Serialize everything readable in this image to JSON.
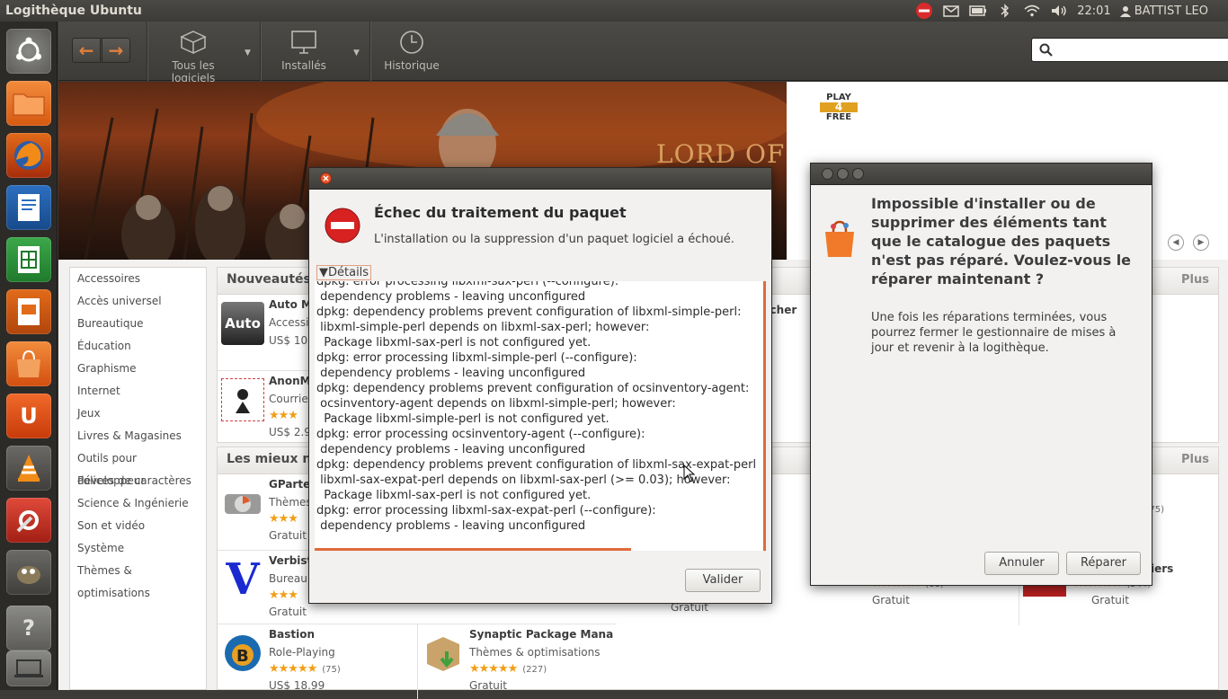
{
  "panel": {
    "title": "Logithèque Ubuntu",
    "time": "22:01",
    "user": "BATTIST LEO"
  },
  "toolbar": {
    "back": "←",
    "forward": "→",
    "all_software": "Tous les logiciels",
    "installed": "Installés",
    "history": "Historique",
    "search_placeholder": ""
  },
  "banner": {
    "text": "LORD OF",
    "logo_top": "PLAY",
    "logo_mid": "4",
    "logo_bot": "FREE"
  },
  "categories": [
    "Accessoires",
    "Accès universel",
    "Bureautique",
    "Éducation",
    "Graphisme",
    "Internet",
    "Jeux",
    "Livres & Magasines",
    "Outils pour développeur",
    "Polices de caractères",
    "Science & Ingénierie",
    "Son et vidéo",
    "Système",
    "Thèmes & optimisations"
  ],
  "sections": {
    "new": "Nouveautés",
    "top": "Les mieux no",
    "plus": "Plus"
  },
  "apps": {
    "automa": {
      "name": "Auto Mo",
      "cat": "Accessi",
      "price": "US$ 10"
    },
    "anonma": {
      "name": "AnonMa",
      "cat": "Courrie",
      "price": "US$ 2.9"
    },
    "gparted": {
      "name": "GParted",
      "cat": "Thèmes",
      "price": "Gratuit"
    },
    "verbiste": {
      "name": "Verbiste",
      "cat": "Bureau",
      "price": "Gratuit"
    },
    "bastion": {
      "name": "Bastion",
      "cat": "Role-Playing",
      "stars": "★★★★★",
      "count": "(75)",
      "price": "US$ 18.99"
    },
    "synaptic": {
      "name": "Synaptic Package Manager",
      "cat": "Thèmes & optimisations",
      "stars": "★★★★★",
      "count": "(227)",
      "price": "Gratuit"
    },
    "mid1": {
      "price": "Gratuit"
    },
    "r2": {
      "stars": "★★★★★",
      "count": "(88)",
      "price": "Gratuit"
    },
    "r3": {
      "name": "iers",
      "stars": "★★★★★",
      "count": "(344)",
      "price": "Gratuit"
    },
    "r4": {
      "count": "375)"
    },
    "r5": {
      "count": "6)"
    },
    "launcher": {
      "name": "ncher"
    }
  },
  "error_dialog": {
    "title": "Échec du traitement du paquet",
    "message": "L'installation ou la suppression d'un paquet logiciel a échoué.",
    "details_label": "Détails",
    "log": [
      "dpkg: error processing libxml-sax-perl (--configure):",
      " dependency problems - leaving unconfigured",
      "dpkg: dependency problems prevent configuration of libxml-simple-perl:",
      " libxml-simple-perl depends on libxml-sax-perl; however:",
      "  Package libxml-sax-perl is not configured yet.",
      "dpkg: error processing libxml-simple-perl (--configure):",
      " dependency problems - leaving unconfigured",
      "dpkg: dependency problems prevent configuration of ocsinventory-agent:",
      " ocsinventory-agent depends on libxml-simple-perl; however:",
      "  Package libxml-simple-perl is not configured yet.",
      "dpkg: error processing ocsinventory-agent (--configure):",
      " dependency problems - leaving unconfigured",
      "dpkg: dependency problems prevent configuration of libxml-sax-expat-perl",
      " libxml-sax-expat-perl depends on libxml-sax-perl (>= 0.03); however:",
      "  Package libxml-sax-perl is not configured yet.",
      "dpkg: error processing libxml-sax-expat-perl (--configure):",
      " dependency problems - leaving unconfigured"
    ],
    "ok_button": "Valider"
  },
  "repair_dialog": {
    "heading": "Impossible d'installer ou de supprimer des éléments tant que le catalogue des paquets n'est pas réparé. Voulez-vous le réparer maintenant ?",
    "body": "Une fois les réparations terminées, vous pourrez fermer le gestionnaire de mises à jour et revenir à la logithèque.",
    "cancel_button": "Annuler",
    "repair_button": "Réparer"
  },
  "colors": {
    "accent": "#dd4814",
    "panel": "#3c3b37",
    "star": "#f29e16"
  }
}
